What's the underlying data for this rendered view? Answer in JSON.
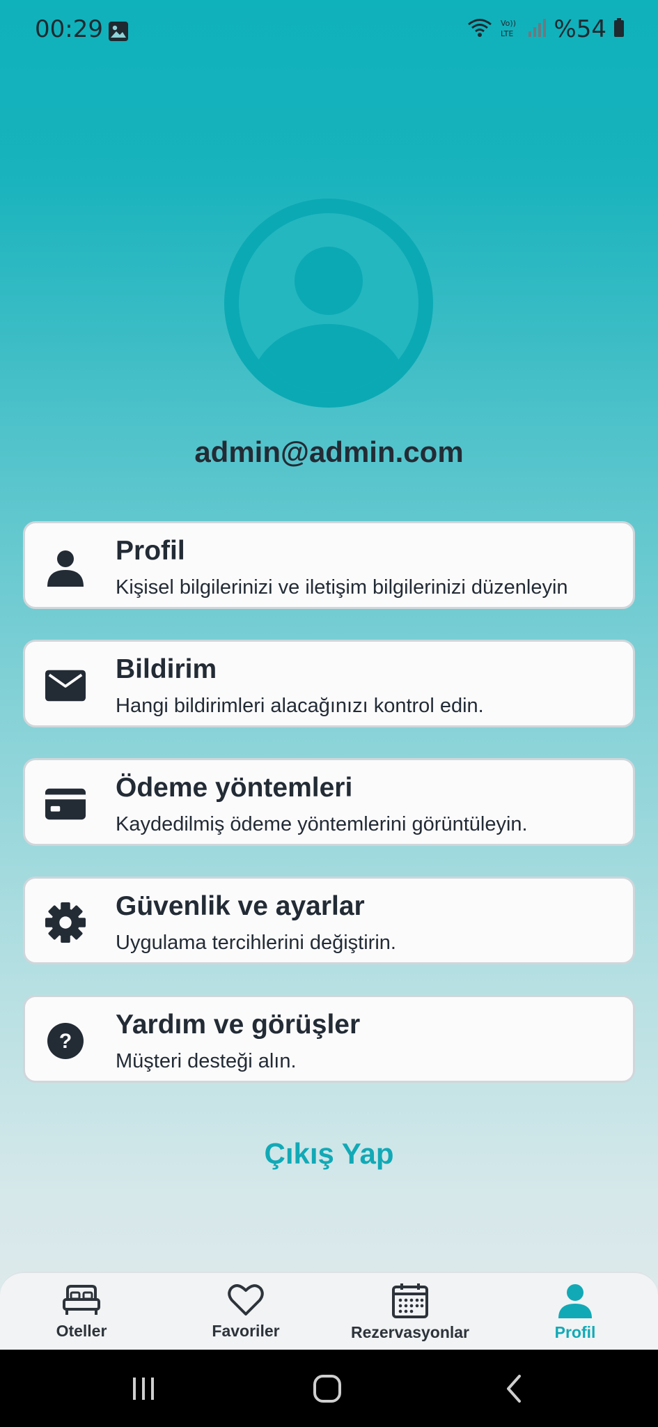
{
  "status": {
    "time": "00:29",
    "battery_text": "%54"
  },
  "profile": {
    "email": "admin@admin.com"
  },
  "menu": [
    {
      "icon": "person-icon",
      "title": "Profil",
      "subtitle": "Kişisel bilgilerinizi ve iletişim bilgilerinizi düzenleyin"
    },
    {
      "icon": "mail-icon",
      "title": "Bildirim",
      "subtitle": "Hangi bildirimleri alacağınızı kontrol edin."
    },
    {
      "icon": "credit-card-icon",
      "title": "Ödeme yöntemleri",
      "subtitle": "Kaydedilmiş ödeme yöntemlerini görüntüleyin."
    },
    {
      "icon": "gear-icon",
      "title": "Güvenlik ve ayarlar",
      "subtitle": "Uygulama tercihlerini değiştirin."
    },
    {
      "icon": "help-circle-icon",
      "title": "Yardım ve görüşler",
      "subtitle": "Müşteri desteği alın."
    }
  ],
  "logout_label": "Çıkış Yap",
  "bottom_nav": [
    {
      "icon": "bed-icon",
      "label": "Oteller",
      "active": false
    },
    {
      "icon": "heart-icon",
      "label": "Favoriler",
      "active": false
    },
    {
      "icon": "calendar-icon",
      "label": "Rezervasyonlar",
      "active": false
    },
    {
      "icon": "person-icon",
      "label": "Profil",
      "active": true
    }
  ],
  "colors": {
    "accent": "#12a9b6",
    "text": "#232b35",
    "card": "#fbfbfc"
  }
}
